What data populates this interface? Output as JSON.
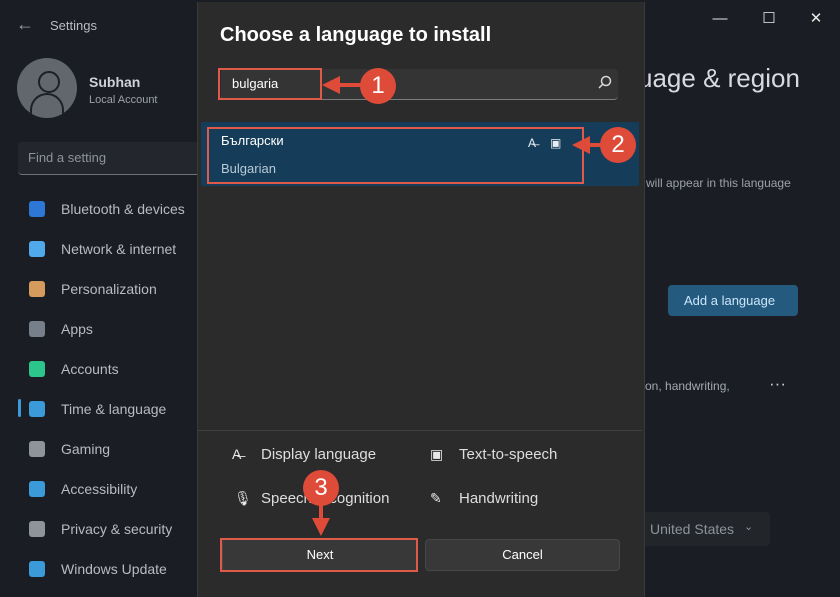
{
  "window": {
    "app_title": "Settings",
    "back_icon": "back-arrow-icon",
    "minimize_icon": "minimize-icon",
    "maximize_icon": "maximize-icon",
    "close_icon": "close-icon"
  },
  "user": {
    "name": "Subhan",
    "account_type": "Local Account",
    "avatar_icon": "person-icon"
  },
  "search": {
    "placeholder": "Find a setting"
  },
  "sidebar": {
    "items": [
      {
        "label": "Bluetooth & devices",
        "icon": "bluetooth-icon",
        "color": "#2d78d6"
      },
      {
        "label": "Network & internet",
        "icon": "wifi-icon",
        "color": "#4fa9ea"
      },
      {
        "label": "Personalization",
        "icon": "paintbrush-icon",
        "color": "#d59b5c"
      },
      {
        "label": "Apps",
        "icon": "apps-icon",
        "color": "#77808a"
      },
      {
        "label": "Accounts",
        "icon": "accounts-icon",
        "color": "#2cc68c"
      },
      {
        "label": "Time & language",
        "icon": "clock-globe-icon",
        "color": "#3a9bd8"
      },
      {
        "label": "Gaming",
        "icon": "controller-icon",
        "color": "#8e949a"
      },
      {
        "label": "Accessibility",
        "icon": "accessibility-icon",
        "color": "#3a9bd8"
      },
      {
        "label": "Privacy & security",
        "icon": "shield-icon",
        "color": "#8e949a"
      },
      {
        "label": "Windows Update",
        "icon": "update-icon",
        "color": "#3a9bd8"
      }
    ]
  },
  "main": {
    "title": "uage & region",
    "note": "will appear in this language",
    "add_language_label": "Add a language",
    "row_text": "on, handwriting,",
    "more_icon": "ellipsis-icon",
    "region_value": "United States",
    "region_chevron_icon": "chevron-down-icon"
  },
  "dialog": {
    "title": "Choose a language to install",
    "search_value": "bulgaria",
    "search_icon": "search-icon",
    "result": {
      "native_name": "Български",
      "english_name": "Bulgarian",
      "display_icon": "display-language-icon",
      "tts_icon": "text-to-speech-icon"
    },
    "legend": [
      {
        "icon": "display-language-icon",
        "label": "Display language"
      },
      {
        "icon": "text-to-speech-icon",
        "label": "Text-to-speech"
      },
      {
        "icon": "microphone-icon",
        "label": "Speech recognition"
      },
      {
        "icon": "handwriting-icon",
        "label": "Handwriting"
      }
    ],
    "next_label": "Next",
    "cancel_label": "Cancel"
  },
  "annotations": {
    "markers": [
      "1",
      "2",
      "3"
    ],
    "accent_color": "#df4b39"
  }
}
